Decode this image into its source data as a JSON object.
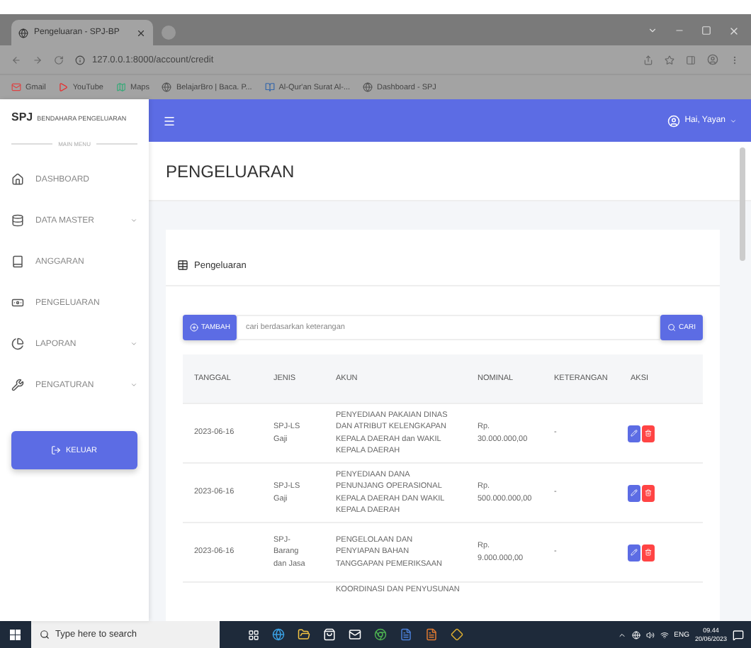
{
  "browser": {
    "tab_title": "Pengeluaran - SPJ-BP",
    "url": "127.0.0.1:8000/account/credit",
    "bookmarks": [
      {
        "label": "Gmail",
        "kind": "mail"
      },
      {
        "label": "YouTube",
        "kind": "video"
      },
      {
        "label": "Maps",
        "kind": "map"
      },
      {
        "label": "BelajarBro | Baca. P...",
        "kind": "site"
      },
      {
        "label": "Al-Qur'an Surat Al-...",
        "kind": "book"
      },
      {
        "label": "Dashboard - SPJ",
        "kind": "site"
      }
    ]
  },
  "sidebar": {
    "brand": "SPJ",
    "subtitle": "BENDAHARA PENGELUARAN",
    "menu_label": "MAIN MENU",
    "items": [
      {
        "label": "DASHBOARD",
        "has_submenu": false
      },
      {
        "label": "DATA MASTER",
        "has_submenu": true
      },
      {
        "label": "ANGGARAN",
        "has_submenu": false
      },
      {
        "label": "PENGELUARAN",
        "has_submenu": false
      },
      {
        "label": "LAPORAN",
        "has_submenu": true
      },
      {
        "label": "PENGATURAN",
        "has_submenu": true
      }
    ],
    "logout": "KELUAR"
  },
  "topbar": {
    "user": "Hai, Yayan"
  },
  "page_title": "PENGELUARAN",
  "card": {
    "title": "Pengeluaran",
    "add_button": "TAMBAH",
    "search_placeholder": "cari berdasarkan keterangan",
    "search_button": "CARI",
    "columns": [
      "TANGGAL",
      "JENIS",
      "AKUN",
      "NOMINAL",
      "KETERANGAN",
      "AKSI"
    ],
    "rows": [
      {
        "tanggal": "2023-06-16",
        "jenis": "SPJ-LS Gaji",
        "akun": "PENYEDIAAN PAKAIAN DINAS DAN ATRIBUT KELENGKAPAN KEPALA DAERAH dan WAKIL KEPALA DAERAH",
        "nominal": "Rp. 30.000.000,00",
        "keterangan": "-"
      },
      {
        "tanggal": "2023-06-16",
        "jenis": "SPJ-LS Gaji",
        "akun": "PENYEDIAAN DANA PENUNJANG OPERASIONAL KEPALA DAERAH DAN WAKIL KEPALA DAERAH",
        "nominal": "Rp. 500.000.000,00",
        "keterangan": "-"
      },
      {
        "tanggal": "2023-06-16",
        "jenis": "SPJ-Barang dan Jasa",
        "akun": "PENGELOLAAN DAN PENYIAPAN BAHAN TANGGAPAN PEMERIKSAAN",
        "nominal": "Rp. 9.000.000,00",
        "keterangan": "-"
      }
    ],
    "partial_row": {
      "akun": "KOORDINASI DAN PENYUSUNAN"
    }
  },
  "taskbar": {
    "search_placeholder": "Type here to search",
    "language": "ENG",
    "time": "09.44",
    "date": "20/06/2023"
  }
}
